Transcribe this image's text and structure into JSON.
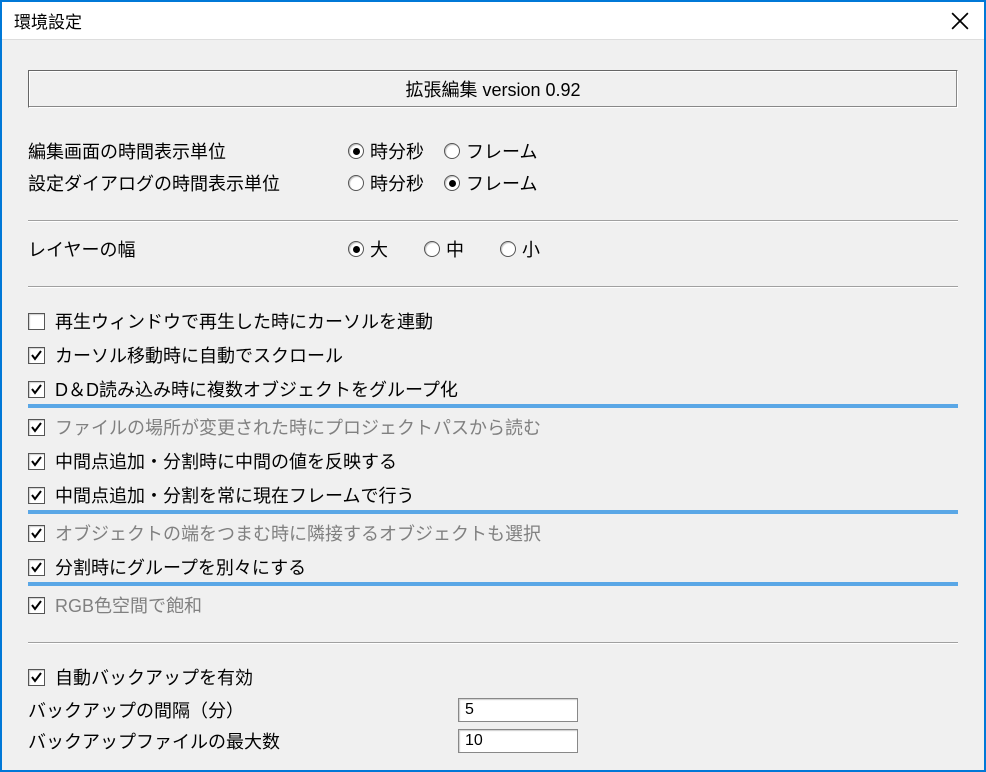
{
  "window": {
    "title": "環境設定"
  },
  "version": {
    "text": "拡張編集 version 0.92"
  },
  "time_unit": {
    "row1": {
      "label": "編集画面の時間表示単位",
      "options": [
        {
          "label": "時分秒",
          "selected": true
        },
        {
          "label": "フレーム",
          "selected": false
        }
      ]
    },
    "row2": {
      "label": "設定ダイアログの時間表示単位",
      "options": [
        {
          "label": "時分秒",
          "selected": false
        },
        {
          "label": "フレーム",
          "selected": true
        }
      ]
    }
  },
  "layer_width": {
    "label": "レイヤーの幅",
    "options": [
      {
        "label": "大",
        "selected": true
      },
      {
        "label": "中",
        "selected": false
      },
      {
        "label": "小",
        "selected": false
      }
    ]
  },
  "checkboxes": {
    "c0": {
      "label": "再生ウィンドウで再生した時にカーソルを連動",
      "checked": false,
      "highlighted": false
    },
    "c1": {
      "label": "カーソル移動時に自動でスクロール",
      "checked": true,
      "highlighted": false
    },
    "c2": {
      "label": "D＆D読み込み時に複数オブジェクトをグループ化",
      "checked": true,
      "highlighted": true
    },
    "c3": {
      "label": "ファイルの場所が変更された時にプロジェクトパスから読む",
      "checked": true,
      "highlighted": false,
      "gray": true
    },
    "c4": {
      "label": "中間点追加・分割時に中間の値を反映する",
      "checked": true,
      "highlighted": false
    },
    "c5": {
      "label": "中間点追加・分割を常に現在フレームで行う",
      "checked": true,
      "highlighted": true
    },
    "c6": {
      "label": "オブジェクトの端をつまむ時に隣接するオブジェクトも選択",
      "checked": true,
      "highlighted": false,
      "gray": true
    },
    "c7": {
      "label": "分割時にグループを別々にする",
      "checked": true,
      "highlighted": true
    },
    "c8": {
      "label": "RGB色空間で飽和",
      "checked": true,
      "highlighted": false,
      "gray": true
    }
  },
  "backup": {
    "enable": {
      "label": "自動バックアップを有効",
      "checked": true
    },
    "interval": {
      "label": "バックアップの間隔（分）",
      "value": "5"
    },
    "max": {
      "label": "バックアップファイルの最大数",
      "value": "10"
    }
  }
}
